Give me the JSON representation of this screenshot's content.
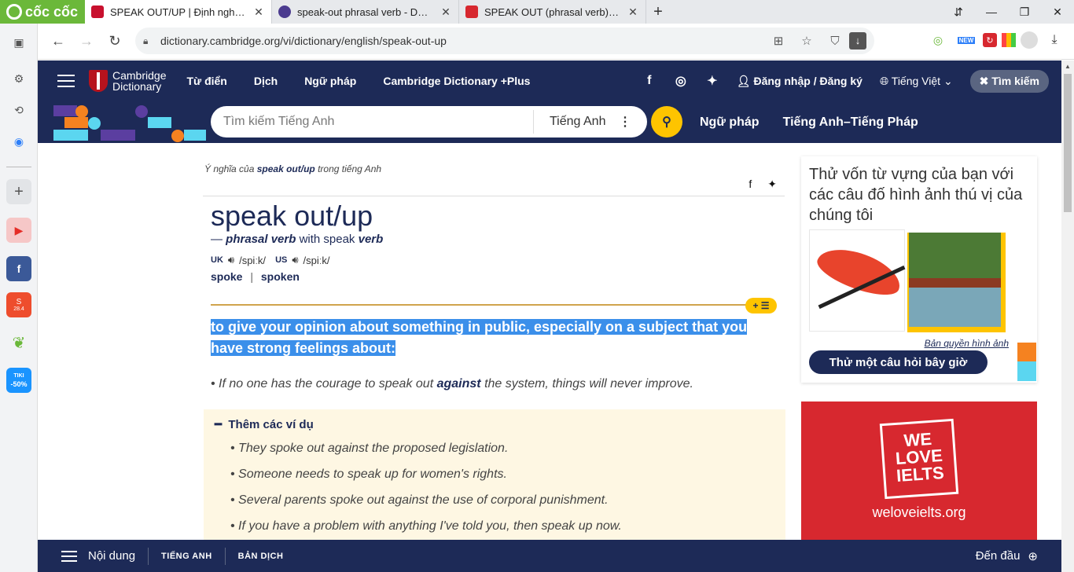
{
  "browser": {
    "brand": "cốc cốc",
    "tabs": [
      {
        "title": "SPEAK OUT/UP | Định nghĩa trong Từ điển tiếng Anh Cambridge",
        "favicon_color": "#c8102e",
        "active": true
      },
      {
        "title": "speak-out phrasal verb - Definition",
        "favicon_color": "#4b3b8f",
        "active": false
      },
      {
        "title": "SPEAK OUT (phrasal verb) definition",
        "favicon_color": "#d7282f",
        "active": false
      }
    ],
    "url": "dictionary.cambridge.org/vi/dictionary/english/speak-out-up",
    "extensions": [
      "coccoc-icon",
      "new-badge-icon",
      "red-app-icon",
      "color-grid-icon",
      "avatar-icon",
      "download-icon"
    ],
    "new_badge": "NEW"
  },
  "left_sidebar": {
    "items": [
      "panel-icon",
      "settings-icon",
      "history-icon",
      "messenger-icon",
      "add-icon",
      "youtube-icon",
      "facebook-icon",
      "shopee-icon",
      "coccoc-leaf-icon",
      "tiki-icon"
    ],
    "shopee_badge": "28.4",
    "tiki_label": "TIKI",
    "tiki_badge": "-50%"
  },
  "header": {
    "logo_line1": "Cambridge",
    "logo_line2": "Dictionary",
    "nav": [
      "Từ điển",
      "Dịch",
      "Ngữ pháp",
      "Cambridge Dictionary +Plus"
    ],
    "login": "Đăng nhập / Đăng ký",
    "language": "Tiếng Việt",
    "search_toggle": "Tìm kiếm"
  },
  "search": {
    "placeholder": "Tìm kiếm Tiếng Anh",
    "language": "Tiếng Anh",
    "links": [
      "Ngữ pháp",
      "Tiếng Anh–Tiếng Pháp"
    ]
  },
  "entry": {
    "crumb_prefix": "Ý nghĩa của",
    "crumb_word": "speak out/up",
    "crumb_suffix": "trong tiếng Anh",
    "headword": "speak out/up",
    "pos_dash": "—",
    "pos": "phrasal verb",
    "pos_with": "with speak",
    "pos_verb": "verb",
    "uk_label": "UK",
    "uk_ipa": "/spiːk/",
    "us_label": "US",
    "us_ipa": "/spiːk/",
    "form1": "spoke",
    "form_sep": "|",
    "form2": "spoken",
    "definition": "to give your opinion about something in public, especially on a subject that you have strong feelings about:",
    "example_pre": "If no one has the courage to speak out",
    "example_bold": "against",
    "example_post": "the system, things will never improve.",
    "more_title": "Thêm các ví dụ",
    "more_examples": [
      "They spoke out against the proposed legislation.",
      "Someone needs to speak up for women's rights.",
      "Several parents spoke out against the use of corporal punishment.",
      "If you have a problem with anything I've told you, then speak up now."
    ]
  },
  "quiz": {
    "title": "Thử vốn từ vựng của bạn với các câu đố hình ảnh thú vị của chúng tôi",
    "copyright": "Bản quyền hình ảnh",
    "button": "Thử một câu hỏi bây giờ"
  },
  "ad": {
    "line1": "WE",
    "line2": "LOVE",
    "line3": "IELTS",
    "site": "weloveielts.org"
  },
  "bottom": {
    "menu": "Nội dung",
    "tab1": "TIẾNG ANH",
    "tab2": "BẢN DỊCH",
    "top": "Đến đầu"
  }
}
